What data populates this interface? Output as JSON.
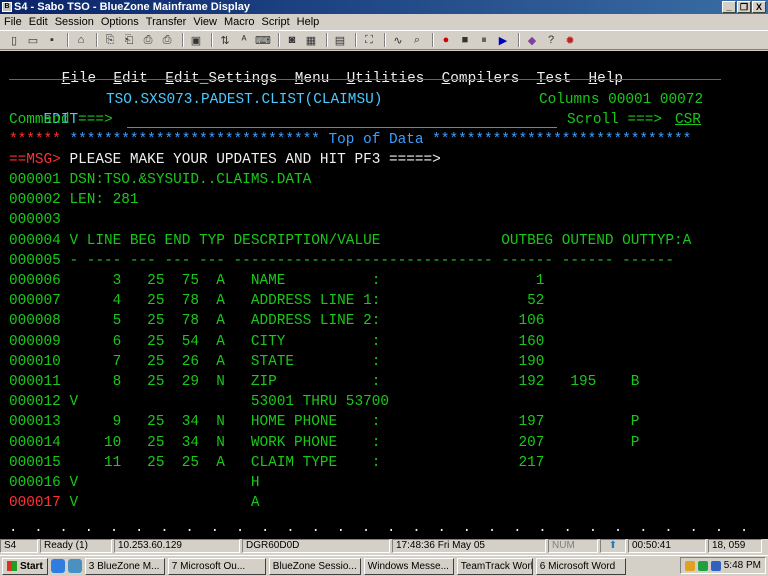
{
  "window": {
    "title": "S4 - Sabo TSO - BlueZone Mainframe Display",
    "buttons": {
      "minimize": "_",
      "restore": "❐",
      "close": "X"
    }
  },
  "menubar": [
    "File",
    "Edit",
    "Session",
    "Options",
    "Transfer",
    "View",
    "Macro",
    "Script",
    "Help"
  ],
  "toolbar": {
    "icons": [
      "new-icon",
      "open-icon",
      "save-icon",
      "sep",
      "home-icon",
      "sep",
      "copy-icon",
      "paste-icon",
      "print-icon",
      "print-setup-icon",
      "sep",
      "display-icon",
      "sep",
      "transfer-icon",
      "font-icon",
      "keyboard-icon",
      "sep",
      "camera-icon",
      "color-icon",
      "sep",
      "clipboard-icon",
      "sep",
      "capture-icon",
      "sep",
      "macro-icon",
      "find-icon",
      "sep",
      "record-icon",
      "stop-icon",
      "pause-icon",
      "play-icon",
      "sep",
      "book-icon",
      "help-icon",
      "bomb-icon"
    ],
    "glyphs": [
      "▯",
      "▭",
      "▪",
      "|",
      "⌂",
      "|",
      "⎘",
      "⎗",
      "⎙",
      "⎙",
      "|",
      "▣",
      "|",
      "⇅",
      "ᴬ",
      "⌨",
      "|",
      "◙",
      "▦",
      "|",
      "▤",
      "|",
      "⛶",
      "|",
      "∿",
      "⌕",
      "|",
      "●",
      "■",
      "⏸",
      "▶",
      "|",
      "◆",
      "?",
      "✹"
    ]
  },
  "ispf_menu": [
    {
      "key": "F",
      "rest": "ile"
    },
    {
      "key": "E",
      "rest": "dit"
    },
    {
      "key": "E",
      "rest": "dit_Settings"
    },
    {
      "key": "M",
      "rest": "enu"
    },
    {
      "key": "U",
      "rest": "tilities"
    },
    {
      "key": "C",
      "rest": "ompilers"
    },
    {
      "key": "T",
      "rest": "est"
    },
    {
      "key": "H",
      "rest": "elp"
    }
  ],
  "editor": {
    "mode": "EDIT",
    "dataset": "TSO.SXS073.PADEST.CLIST(CLAIMSU)",
    "columns": "Columns 00001 00072",
    "command_label": "Command ===>",
    "command_value": "",
    "scroll_label": "Scroll ===>",
    "scroll_value": "CSR",
    "top_stars": "******",
    "top_of_data": " ***************************** Top of Data ******************************",
    "msg_tag": "==MSG>",
    "msg_text": " PLEASE MAKE YOUR UPDATES AND HIT PF3 =====>",
    "lines": [
      {
        "num": "000001",
        "text": " DSN:TSO.&SYSUID..CLAIMS.DATA"
      },
      {
        "num": "000002",
        "text": " LEN: 281"
      },
      {
        "num": "000003",
        "text": ""
      },
      {
        "num": "000004",
        "text": " V LINE BEG END TYP DESCRIPTION/VALUE              OUTBEG OUTEND OUTTYP:A"
      },
      {
        "num": "000005",
        "text": " - ---- --- --- --- ------------------------------ ------ ------ ------"
      },
      {
        "num": "000006",
        "text": "      3   25  75  A   NAME          :                  1"
      },
      {
        "num": "000007",
        "text": "      4   25  78  A   ADDRESS LINE 1:                 52"
      },
      {
        "num": "000008",
        "text": "      5   25  78  A   ADDRESS LINE 2:                106"
      },
      {
        "num": "000009",
        "text": "      6   25  54  A   CITY          :                160"
      },
      {
        "num": "000010",
        "text": "      7   25  26  A   STATE         :                190"
      },
      {
        "num": "000011",
        "text": "      8   25  29  N   ZIP           :                192   195    B"
      },
      {
        "num": "000012",
        "text": " V                    53001 THRU 53700"
      },
      {
        "num": "000013",
        "text": "      9   25  34  N   HOME PHONE    :                197          P"
      },
      {
        "num": "000014",
        "text": "     10   25  34  N   WORK PHONE    :                207          P"
      },
      {
        "num": "000015",
        "text": "     11   25  25  A   CLAIM TYPE    :                217"
      },
      {
        "num": "000016",
        "text": " V                    H"
      },
      {
        "num": "000017",
        "text": " V                    A"
      }
    ],
    "dots": ".  .  .  .  .  .  .  .  .  .  .  .  .  .  .  .  .  .  .  .  .  .  .  .  .  .  .  .  .  .  .  .  .  .  .  .  .  .  .  .  .  .  .  .  .  .  .  .  ."
  },
  "statusbar": {
    "session": "S4",
    "state": "Ready (1)",
    "host": "10.253.60.129",
    "lu": "DGR60D0D",
    "datetime": "17:48:36  Fri May 05",
    "num": "NUM",
    "elapsed": "00:50:41",
    "cursor": "18, 059"
  },
  "taskbar": {
    "start": "Start",
    "buttons": [
      {
        "label": "3 BlueZone M...",
        "active": true
      },
      {
        "label": "7 Microsoft Ou...",
        "active": false
      },
      {
        "label": "BlueZone Sessio...",
        "active": false
      },
      {
        "label": "Windows Messe...",
        "active": false
      },
      {
        "label": "TeamTrack Work...",
        "active": false
      },
      {
        "label": "6 Microsoft Word",
        "active": false
      }
    ],
    "clock": "5:48 PM"
  },
  "colors": {
    "terminal_bg": "#000000",
    "field_green": "#19c819",
    "header_cyan": "#4cc9ff",
    "rule_blue": "#2a66ff",
    "error_red": "#ff3030",
    "titlebar_blue": "#0a246a"
  }
}
